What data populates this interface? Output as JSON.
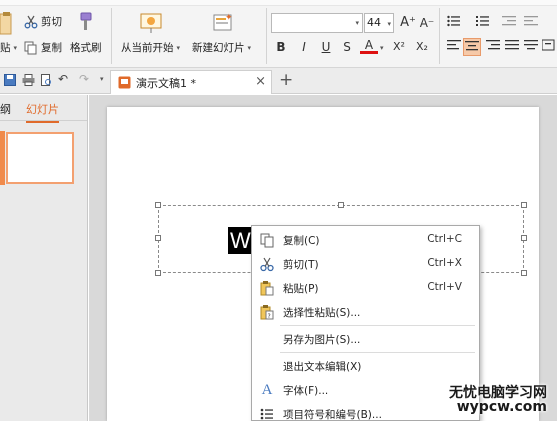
{
  "ribbon": {
    "paste_label": "贴",
    "cut_label": "剪切",
    "copy_label": "复制",
    "format_painter_label": "格式刷",
    "from_current_label": "从当前开始",
    "new_slide_label": "新建幻灯片",
    "font_size": "44",
    "bold": "B",
    "italic": "I",
    "underline": "U",
    "shadow": "S",
    "font_color": "A",
    "superscript": "X²",
    "subscript": "X₂",
    "grow_font": "A⁺",
    "shrink_font": "A⁻"
  },
  "tabbar": {
    "doc_title": "演示文稿1 *",
    "close": "×",
    "new_tab": "+"
  },
  "sidepane": {
    "outline_tab": "纲",
    "slides_tab": "幻灯片"
  },
  "slide": {
    "selected_text": "Wo"
  },
  "context_menu": {
    "items": [
      {
        "label": "复制(C)",
        "shortcut": "Ctrl+C",
        "icon": "copy-icon"
      },
      {
        "label": "剪切(T)",
        "shortcut": "Ctrl+X",
        "icon": "scissors-icon"
      },
      {
        "label": "粘贴(P)",
        "shortcut": "Ctrl+V",
        "icon": "paste-icon"
      },
      {
        "label": "选择性粘贴(S)...",
        "shortcut": "",
        "icon": "paste-special-icon"
      },
      {
        "label": "另存为图片(S)...",
        "shortcut": "",
        "icon": ""
      },
      {
        "label": "退出文本编辑(X)",
        "shortcut": "",
        "icon": ""
      },
      {
        "label": "字体(F)...",
        "shortcut": "",
        "icon": "font-icon"
      },
      {
        "label": "项目符号和编号(B)...",
        "shortcut": "",
        "icon": "bullet-list-icon"
      }
    ]
  },
  "watermark": {
    "line1": "无忧电脑学习网",
    "line2": "wypcw.com"
  },
  "colors": {
    "accent": "#e06a2a",
    "ribbon_bg": "#f4f4f4",
    "workarea_bg": "#d9d9d9"
  }
}
